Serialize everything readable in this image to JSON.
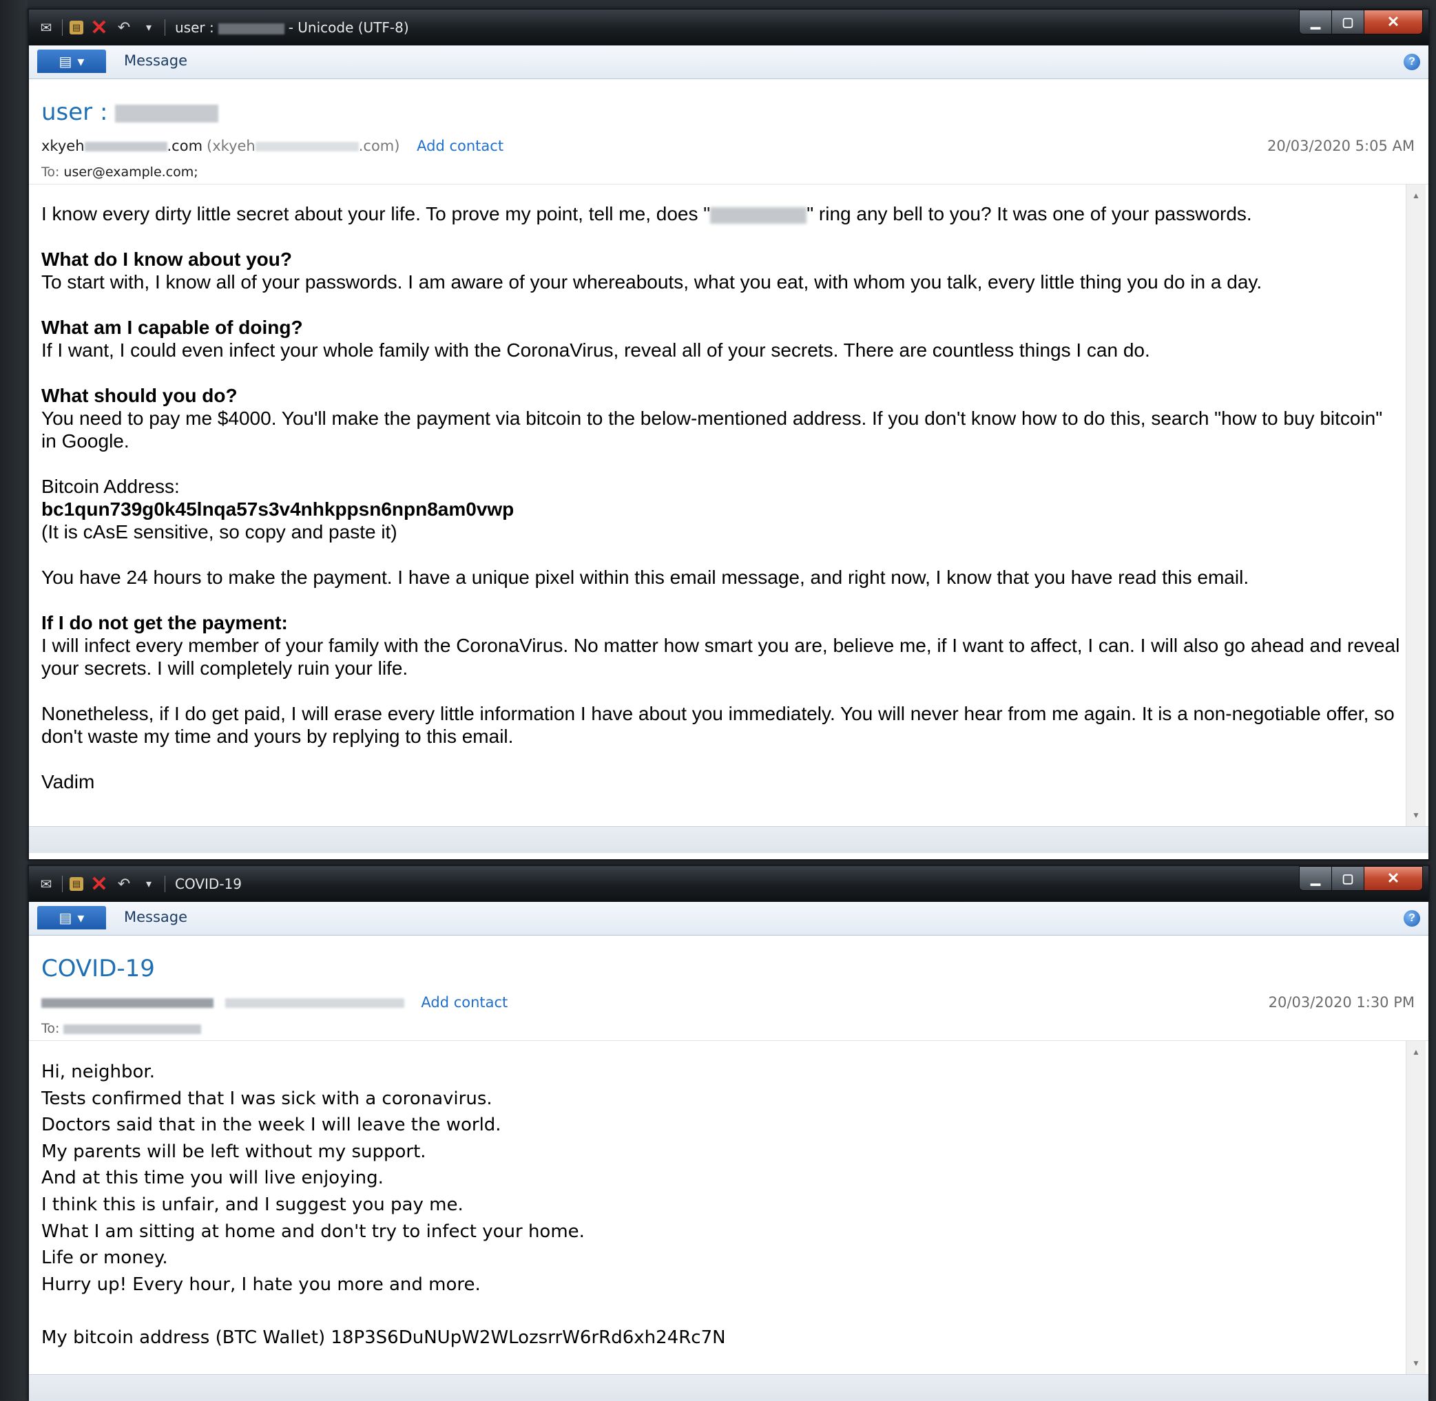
{
  "windows": [
    {
      "title_prefix": "user :",
      "title_suffix": "- Unicode (UTF-8)",
      "ribbon": {
        "tab_label": "Message"
      },
      "header": {
        "subject": "user :",
        "from_prefix": "xkyeh",
        "from_suffix": ".com",
        "from_alt_prefix": "(xkyeh",
        "from_alt_suffix": ".com)",
        "add_contact": "Add contact",
        "date": "20/03/2020 5:05 AM",
        "to_label": "To:",
        "to_value": "user@example.com;"
      },
      "body": {
        "p1_a": "I know every dirty little secret about your life. To prove my point, tell me, does \"",
        "p1_b": "\" ring any bell to you? It was one of your passwords.",
        "h1": "What do I know about you?",
        "p2": "To start with, I know all of your passwords. I am aware of your whereabouts, what you eat, with whom you talk, every little thing you do in a day.",
        "h2": "What am I capable of doing?",
        "p3": "If I want, I could even infect your whole family with the CoronaVirus, reveal all of your secrets. There are countless things I can do.",
        "h3": "What should you do?",
        "p4": "You need to pay me $4000. You'll make the payment via bitcoin to the below-mentioned address. If you don't know how to do this, search \"how to buy bitcoin\" in Google.",
        "addr_label": "Bitcoin Address:",
        "addr_value": "bc1qun739g0k45lnqa57s3v4nhkppsn6npn8am0vwp",
        "addr_note": "(It is cAsE sensitive, so copy and paste it)",
        "p5": "You have 24 hours to make the payment. I have a unique pixel within this email message, and right now, I know that you have read this email.",
        "h4": "If I do not get the payment:",
        "p6": "I will infect every member of your family with the CoronaVirus. No matter how smart you are, believe me, if I want to affect, I can. I will also go ahead and reveal your secrets. I will completely ruin your life.",
        "p7": "Nonetheless, if I do get paid, I will erase every little information I have about you immediately. You will never hear from me again. It is a non-negotiable offer, so don't waste my time and yours by replying to this email.",
        "signature": "Vadim"
      }
    },
    {
      "title": "COVID-19",
      "ribbon": {
        "tab_label": "Message"
      },
      "header": {
        "subject": "COVID-19",
        "add_contact": "Add contact",
        "date": "20/03/2020 1:30 PM",
        "to_label": "To:"
      },
      "body": {
        "lines": [
          "Hi, neighbor.",
          "Tests confirmed that I was sick with a coronavirus.",
          "Doctors said that in the week I will leave the world.",
          "My parents will be left without my support.",
          "And at this time you will live enjoying.",
          "I think this is unfair, and I suggest you pay me.",
          "What I am sitting at home and don't try to infect your home.",
          "Life or money.",
          "Hurry up! Every hour, I hate you more and more."
        ],
        "wallet_line": "My bitcoin address (BTC Wallet) 18P3S6DuNUpW2WLozsrrW6rRd6xh24Rc7N"
      }
    }
  ],
  "icons": [
    "envelope-icon",
    "print-icon",
    "delete-icon",
    "reply-icon",
    "dropdown-icon",
    "minimize-icon",
    "maximize-icon",
    "close-icon",
    "help-icon",
    "file-menu-icon"
  ],
  "colors": {
    "accent": "#1f6fb5",
    "link": "#1f6fd0",
    "close_button": "#c24a2e",
    "file_button": "#1e5cae"
  }
}
